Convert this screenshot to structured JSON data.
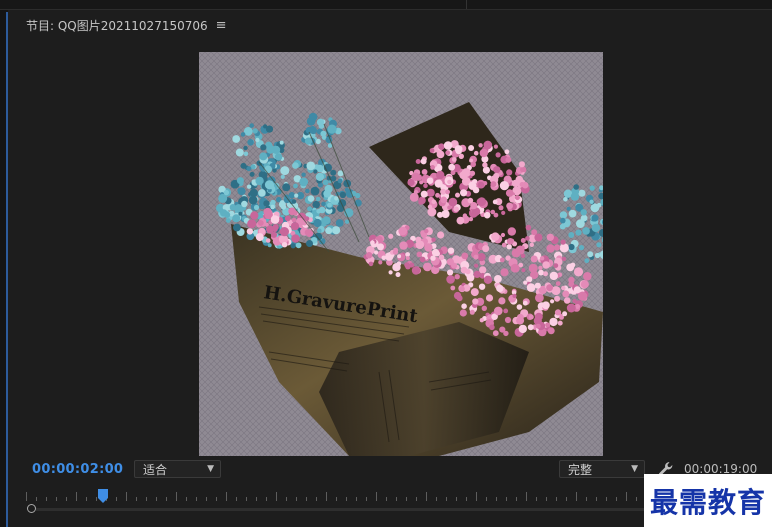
{
  "panel": {
    "title": "节目: QQ图片20211027150706",
    "menu_icon": "hamburger-menu-icon"
  },
  "viewer": {
    "content_description_icon": "program-monitor-frame",
    "newspaper_text": "H.GravurePrint"
  },
  "controls": {
    "current_timecode": "00:00:02:00",
    "fit_select": "适合",
    "resolution_select": "完整",
    "settings_icon": "wrench-icon",
    "duration_timecode": "00:00:19:00"
  },
  "timeline": {
    "playhead_icon": "playhead-icon",
    "scroll_handle_icon": "scroll-handle-icon"
  },
  "watermark": {
    "text": "最需教育"
  },
  "colors": {
    "background": "#1d1d1d",
    "timecode_accent": "#3f8ee6",
    "watermark_text": "#1534a8"
  }
}
